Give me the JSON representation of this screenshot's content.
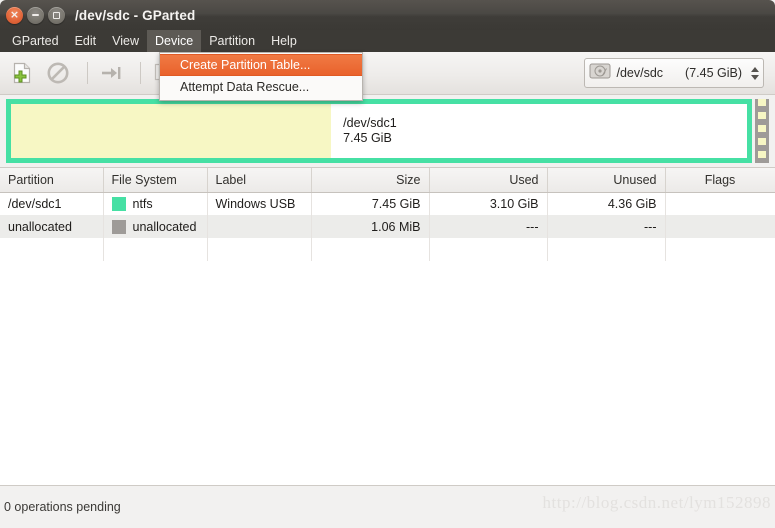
{
  "window": {
    "title": "/dev/sdc - GParted",
    "controls": [
      {
        "name": "close",
        "glyph": "×"
      },
      {
        "name": "minimize",
        "glyph": "−"
      },
      {
        "name": "maximize",
        "glyph": "□"
      }
    ]
  },
  "menubar": {
    "items": [
      {
        "label": "GParted",
        "active": false
      },
      {
        "label": "Edit",
        "active": false
      },
      {
        "label": "View",
        "active": false
      },
      {
        "label": "Device",
        "active": true
      },
      {
        "label": "Partition",
        "active": false
      },
      {
        "label": "Help",
        "active": false
      }
    ]
  },
  "dropdown": {
    "open_for": "Device",
    "items": [
      {
        "label": "Create Partition Table...",
        "selected": true
      },
      {
        "label": "Attempt Data Rescue...",
        "selected": false
      }
    ]
  },
  "toolbar": {
    "icons": [
      {
        "name": "new-partition-icon",
        "title": "New"
      },
      {
        "name": "delete-partition-icon",
        "title": "Delete"
      },
      {
        "name": "apply-operations-icon",
        "title": "Apply"
      },
      {
        "name": "copy-partition-icon",
        "title": "Copy"
      }
    ],
    "device_selector": {
      "icon": "hard-disk-icon",
      "device": "/dev/sdc",
      "size": "(7.45 GiB)"
    }
  },
  "graphic": {
    "partition": {
      "name": "/dev/sdc1",
      "size": "7.45 GiB",
      "border_color": "#46e0a4",
      "used_fill_color": "#f7f7c4"
    },
    "unallocated": {
      "color": "#9e9b98"
    }
  },
  "table": {
    "columns": [
      "Partition",
      "File System",
      "Label",
      "Size",
      "Used",
      "Unused",
      "Flags"
    ],
    "rows": [
      {
        "partition": "/dev/sdc1",
        "filesystem": "ntfs",
        "swatch": "#46e0a4",
        "label": "Windows USB",
        "size": "7.45 GiB",
        "used": "3.10 GiB",
        "unused": "4.36 GiB",
        "flags": ""
      },
      {
        "partition": "unallocated",
        "filesystem": "unallocated",
        "swatch": "#9e9b98",
        "label": "",
        "size": "1.06 MiB",
        "used": "---",
        "unused": "---",
        "flags": ""
      }
    ]
  },
  "statusbar": {
    "text": "0 operations pending"
  },
  "watermark": {
    "text": "http://blog.csdn.net/lym152898"
  }
}
